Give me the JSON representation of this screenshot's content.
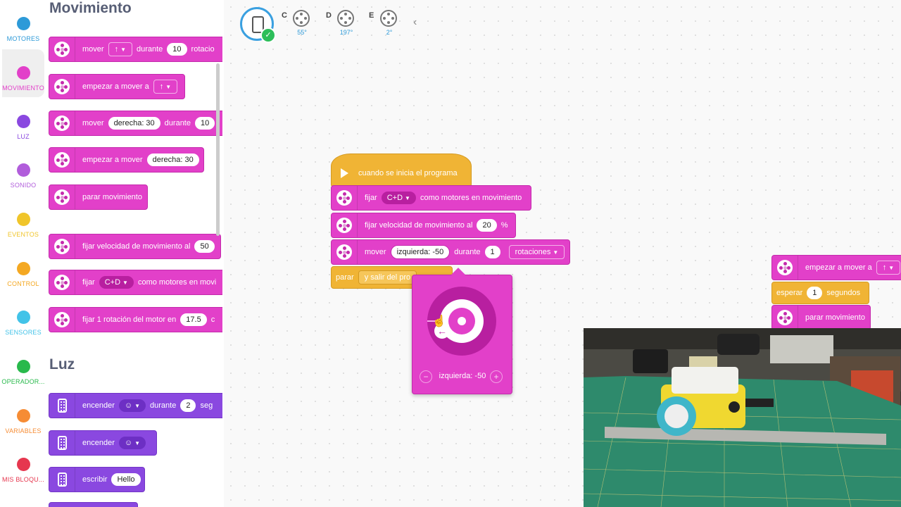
{
  "categories": [
    {
      "label": "MOTORES",
      "color": "#2d9ad8"
    },
    {
      "label": "MOVIMIENTO",
      "color": "#e240c9"
    },
    {
      "label": "LUZ",
      "color": "#8a48e0"
    },
    {
      "label": "SONIDO",
      "color": "#b15ddb"
    },
    {
      "label": "EVENTOS",
      "color": "#f0c52a"
    },
    {
      "label": "CONTROL",
      "color": "#f4a822"
    },
    {
      "label": "SENSORES",
      "color": "#42c3e8"
    },
    {
      "label": "OPERADOR...",
      "color": "#28b94b"
    },
    {
      "label": "VARIABLES",
      "color": "#f68c34"
    },
    {
      "label": "MIS BLOQU...",
      "color": "#e6374f"
    }
  ],
  "palette": {
    "movimiento_title": "Movimiento",
    "luz_title": "Luz",
    "b1": {
      "text": "mover",
      "arrow": "↑",
      "text2": "durante",
      "val": "10",
      "text3": "rotacio"
    },
    "b2": {
      "text": "empezar a mover a",
      "arrow": "↑"
    },
    "b3": {
      "text": "mover",
      "steer": "derecha: 30",
      "text2": "durante",
      "val": "10"
    },
    "b4": {
      "text": "empezar a mover",
      "steer": "derecha: 30"
    },
    "b5": {
      "text": "parar movimiento"
    },
    "b6": {
      "text": "fijar velocidad de movimiento al",
      "val": "50"
    },
    "b7": {
      "text": "fijar",
      "ports": "C+D",
      "text2": "como motores en movi"
    },
    "b8": {
      "text": "fijar 1 rotación del motor en",
      "val": "17.5",
      "text2": "c"
    },
    "l1": {
      "text": "encender",
      "face": "☺",
      "text2": "durante",
      "val": "2",
      "text3": "seg"
    },
    "l2": {
      "text": "encender",
      "face": "☺"
    },
    "l3": {
      "text": "escribir",
      "val": "Hello"
    }
  },
  "ports": [
    {
      "letter": "C",
      "value": "55°"
    },
    {
      "letter": "D",
      "value": "197°"
    },
    {
      "letter": "E",
      "value": "2°"
    }
  ],
  "collapse_icon": "chevron-left",
  "script": {
    "hat": "cuando se inicia el programa",
    "s1": {
      "text": "fijar",
      "ports": "C+D",
      "text2": "como motores en movimiento"
    },
    "s2": {
      "text": "fijar velocidad de movimiento al",
      "val": "20",
      "unit": "%"
    },
    "s3": {
      "text": "mover",
      "steer": "izquierda: -50",
      "text2": "durante",
      "val": "1",
      "unit": "rotaciones"
    },
    "s4": {
      "text": "parar",
      "option": "y salir del pro"
    }
  },
  "dial": {
    "value_label": "izquierda: -50",
    "steering": -50
  },
  "script2": {
    "a1": {
      "text": "empezar a mover a",
      "arrow": "↑"
    },
    "a2": {
      "text": "esperar",
      "val": "1",
      "text2": "segundos"
    },
    "a3": {
      "text": "parar movimiento"
    }
  }
}
